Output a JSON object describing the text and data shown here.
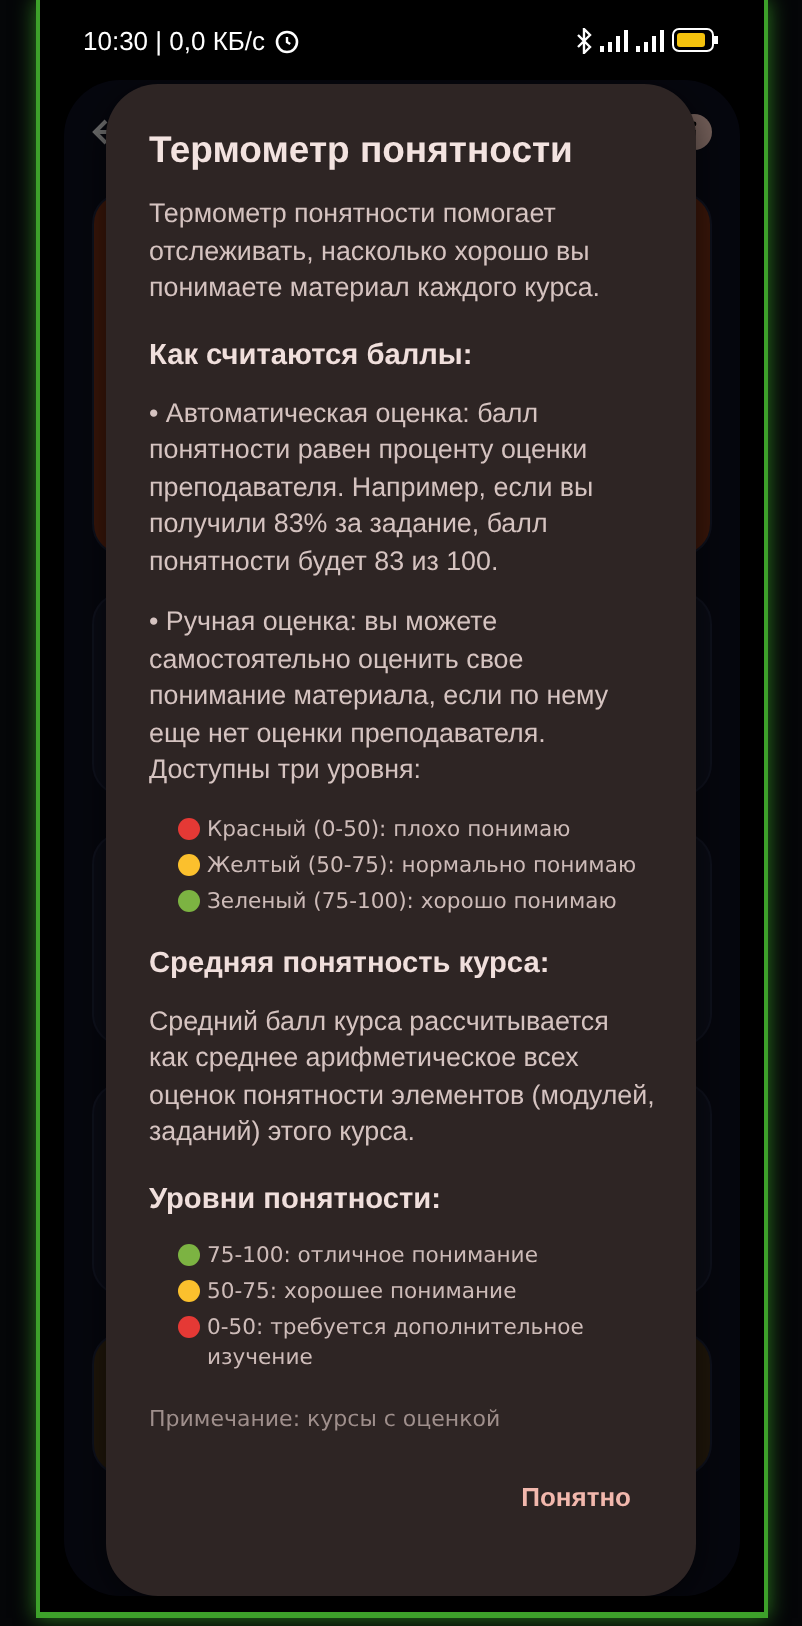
{
  "status_bar": {
    "time": "10:30 | 0,0 КБ/с"
  },
  "dialog": {
    "title": "Термометр понятности",
    "sections": [
      {
        "kind": "paragraph",
        "text": "Термометр понятности помогает отслеживать, насколько хорошо вы понимаете материал каждого курса."
      },
      {
        "kind": "heading",
        "text": "Как считаются баллы:"
      },
      {
        "kind": "paragraph",
        "text": "• Автоматическая оценка: балл понятности равен проценту оценки преподавателя. Например, если вы получили 83% за задание, балл понятности будет 83 из 100."
      },
      {
        "kind": "paragraph",
        "text": "• Ручная оценка: вы можете самостоятельно оценить свое понимание материала, если по нему еще нет оценки преподавателя. Доступны три уровня:"
      },
      {
        "kind": "legend",
        "items": [
          {
            "color": "#e53935",
            "text": "Красный (0-50): плохо понимаю"
          },
          {
            "color": "#fbc02d",
            "text": "Желтый (50-75): нормально понимаю"
          },
          {
            "color": "#7cb342",
            "text": "Зеленый (75-100): хорошо понимаю"
          }
        ]
      },
      {
        "kind": "heading",
        "text": "Средняя понятность курса:"
      },
      {
        "kind": "paragraph",
        "text": "Средний балл курса рассчитывается как среднее арифметическое всех оценок понятности элементов (модулей, заданий) этого курса."
      },
      {
        "kind": "heading",
        "text": "Уровни понятности:"
      },
      {
        "kind": "legend",
        "items": [
          {
            "color": "#7cb342",
            "text": "75-100: отличное понимание"
          },
          {
            "color": "#fbc02d",
            "text": "50-75: хорошее понимание"
          },
          {
            "color": "#e53935",
            "text": "0-50: требуется дополнительное изучение"
          }
        ]
      },
      {
        "kind": "note",
        "text": "Примечание: курсы с оценкой"
      }
    ],
    "button": "Понятно"
  }
}
